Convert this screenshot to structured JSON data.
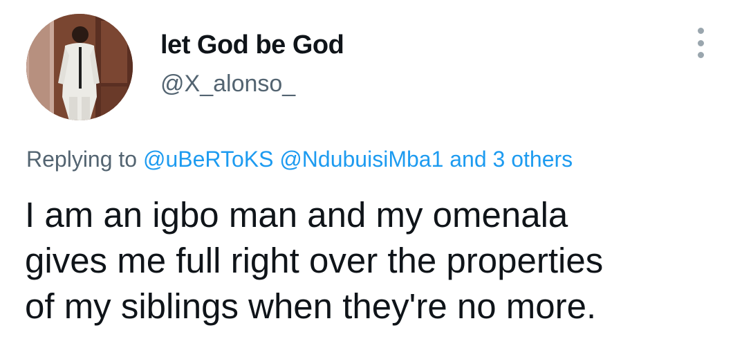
{
  "tweet": {
    "display_name": "let God be God",
    "handle": "@X_alonso_",
    "replying_prefix": "Replying to",
    "mentions": [
      "@uBeRToKS",
      "@NdubuisiMba1"
    ],
    "others_text": "and 3 others",
    "body_lines": [
      "I am an igbo man and my omenala",
      "gives me full right over the properties",
      "of my siblings when they're no more."
    ]
  },
  "icons": {
    "more": "vertical-ellipsis-icon",
    "avatar": "profile-photo"
  },
  "colors": {
    "name": "#0f1419",
    "secondary": "#536471",
    "link": "#1d9bf0"
  }
}
